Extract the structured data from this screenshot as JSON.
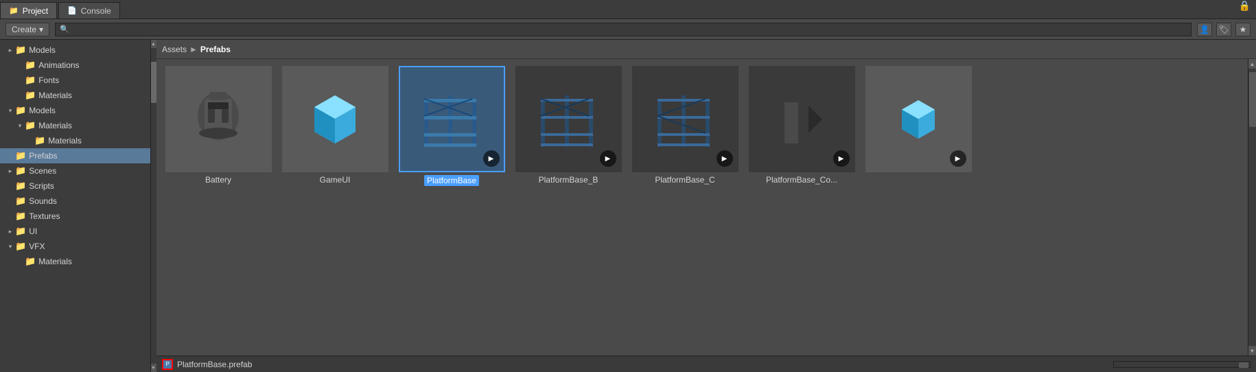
{
  "tabs": [
    {
      "label": "Project",
      "icon": "📁",
      "active": true
    },
    {
      "label": "Console",
      "icon": "📄",
      "active": false
    }
  ],
  "toolbar": {
    "create_label": "Create",
    "create_arrow": "▾",
    "search_placeholder": "",
    "icon_collab": "👤",
    "icon_tag": "🏷",
    "icon_star": "★"
  },
  "sidebar": {
    "items": [
      {
        "label": "Models",
        "indent": 0,
        "arrow": "▸",
        "has_arrow": true,
        "selected": false
      },
      {
        "label": "Animations",
        "indent": 1,
        "arrow": "",
        "has_arrow": false,
        "selected": false
      },
      {
        "label": "Fonts",
        "indent": 1,
        "arrow": "",
        "has_arrow": false,
        "selected": false
      },
      {
        "label": "Materials",
        "indent": 1,
        "arrow": "",
        "has_arrow": false,
        "selected": false
      },
      {
        "label": "Models",
        "indent": 0,
        "arrow": "▾",
        "has_arrow": true,
        "selected": false
      },
      {
        "label": "Materials",
        "indent": 1,
        "arrow": "▾",
        "has_arrow": true,
        "selected": false
      },
      {
        "label": "Materials",
        "indent": 2,
        "arrow": "",
        "has_arrow": false,
        "selected": false
      },
      {
        "label": "Prefabs",
        "indent": 0,
        "arrow": "",
        "has_arrow": false,
        "selected": true
      },
      {
        "label": "Scenes",
        "indent": 0,
        "arrow": "▸",
        "has_arrow": true,
        "selected": false
      },
      {
        "label": "Scripts",
        "indent": 0,
        "arrow": "",
        "has_arrow": false,
        "selected": false
      },
      {
        "label": "Sounds",
        "indent": 0,
        "arrow": "",
        "has_arrow": false,
        "selected": false
      },
      {
        "label": "Textures",
        "indent": 0,
        "arrow": "",
        "has_arrow": false,
        "selected": false
      },
      {
        "label": "UI",
        "indent": 0,
        "arrow": "▸",
        "has_arrow": true,
        "selected": false
      },
      {
        "label": "VFX",
        "indent": 0,
        "arrow": "▾",
        "has_arrow": true,
        "selected": false
      },
      {
        "label": "Materials",
        "indent": 1,
        "arrow": "",
        "has_arrow": false,
        "selected": false
      }
    ]
  },
  "breadcrumb": {
    "root": "Assets",
    "separator": "►",
    "current": "Prefabs"
  },
  "assets": [
    {
      "name": "Battery",
      "type": "model",
      "selected": false,
      "has_play": false
    },
    {
      "name": "GameUI",
      "type": "cube",
      "selected": false,
      "has_play": false
    },
    {
      "name": "PlatformBase",
      "type": "platform",
      "selected": true,
      "has_play": true
    },
    {
      "name": "PlatformBase_B",
      "type": "platform",
      "selected": false,
      "has_play": true
    },
    {
      "name": "PlatformBase_C",
      "type": "platform",
      "selected": false,
      "has_play": true
    },
    {
      "name": "PlatformBase_Co...",
      "type": "platform_dark",
      "selected": false,
      "has_play": true
    }
  ],
  "bottom_item": {
    "name": "PlatformBase.prefab",
    "icon_color": "#4a7aaa",
    "border_color": "#ff0000"
  },
  "status": {
    "filename": "PlatformBase.prefab"
  }
}
